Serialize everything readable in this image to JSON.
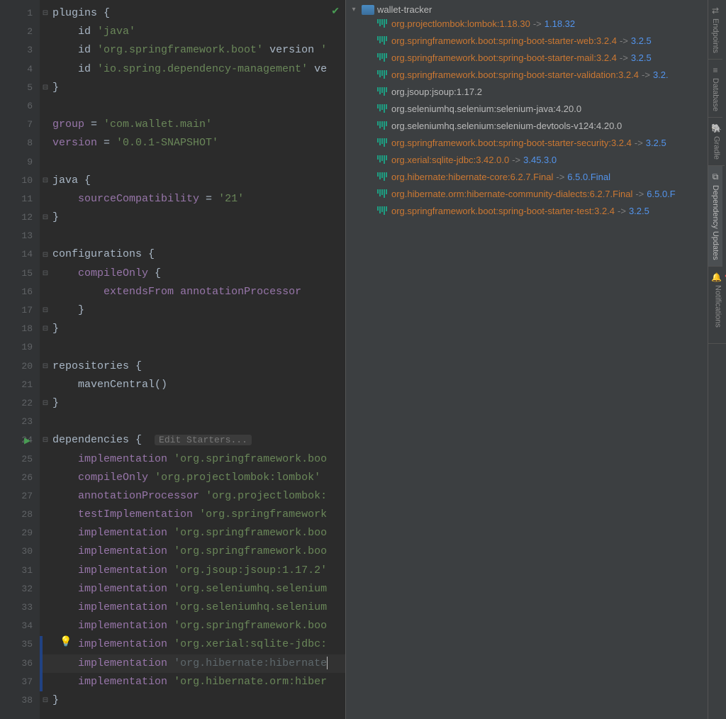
{
  "code_hint": "Edit Starters...",
  "lines": [
    {
      "n": 1,
      "fold": "-",
      "seg": [
        [
          "plain",
          "plugins "
        ],
        [
          "plain",
          "{"
        ]
      ]
    },
    {
      "n": 2,
      "seg": [
        [
          "plain",
          "    id "
        ],
        [
          "str",
          "'java'"
        ]
      ]
    },
    {
      "n": 3,
      "seg": [
        [
          "plain",
          "    id "
        ],
        [
          "str",
          "'org.springframework.boot'"
        ],
        [
          "plain",
          " version "
        ],
        [
          "str",
          "'"
        ]
      ]
    },
    {
      "n": 4,
      "seg": [
        [
          "plain",
          "    id "
        ],
        [
          "str",
          "'io.spring.dependency-management'"
        ],
        [
          "plain",
          " ve"
        ]
      ]
    },
    {
      "n": 5,
      "fold": "-",
      "seg": [
        [
          "plain",
          "}"
        ]
      ]
    },
    {
      "n": 6,
      "seg": []
    },
    {
      "n": 7,
      "seg": [
        [
          "id",
          "group"
        ],
        [
          "plain",
          " = "
        ],
        [
          "str",
          "'com.wallet.main'"
        ]
      ]
    },
    {
      "n": 8,
      "seg": [
        [
          "id",
          "version"
        ],
        [
          "plain",
          " = "
        ],
        [
          "str",
          "'0.0.1-SNAPSHOT'"
        ]
      ]
    },
    {
      "n": 9,
      "seg": []
    },
    {
      "n": 10,
      "fold": "-",
      "seg": [
        [
          "plain",
          "java "
        ],
        [
          "plain",
          "{"
        ]
      ]
    },
    {
      "n": 11,
      "seg": [
        [
          "plain",
          "    "
        ],
        [
          "id",
          "sourceCompatibility"
        ],
        [
          "plain",
          " = "
        ],
        [
          "str",
          "'21'"
        ]
      ]
    },
    {
      "n": 12,
      "fold": "-",
      "seg": [
        [
          "plain",
          "}"
        ]
      ]
    },
    {
      "n": 13,
      "seg": []
    },
    {
      "n": 14,
      "fold": "-",
      "seg": [
        [
          "plain",
          "configurations "
        ],
        [
          "plain",
          "{"
        ]
      ]
    },
    {
      "n": 15,
      "fold": "-",
      "seg": [
        [
          "plain",
          "    "
        ],
        [
          "id",
          "compileOnly"
        ],
        [
          "plain",
          " {"
        ]
      ]
    },
    {
      "n": 16,
      "seg": [
        [
          "plain",
          "        "
        ],
        [
          "id",
          "extendsFrom"
        ],
        [
          "plain",
          " "
        ],
        [
          "id",
          "annotationProcessor"
        ]
      ]
    },
    {
      "n": 17,
      "fold": "-",
      "seg": [
        [
          "plain",
          "    }"
        ]
      ]
    },
    {
      "n": 18,
      "fold": "-",
      "seg": [
        [
          "plain",
          "}"
        ]
      ]
    },
    {
      "n": 19,
      "seg": []
    },
    {
      "n": 20,
      "fold": "-",
      "seg": [
        [
          "plain",
          "repositories "
        ],
        [
          "plain",
          "{"
        ]
      ]
    },
    {
      "n": 21,
      "seg": [
        [
          "plain",
          "    mavenCentral()"
        ]
      ]
    },
    {
      "n": 22,
      "fold": "-",
      "seg": [
        [
          "plain",
          "}"
        ]
      ]
    },
    {
      "n": 23,
      "seg": []
    },
    {
      "n": 24,
      "fold": "-",
      "hint": true,
      "seg": [
        [
          "plain",
          "dependencies "
        ],
        [
          "plain",
          "{  "
        ]
      ]
    },
    {
      "n": 25,
      "seg": [
        [
          "plain",
          "    "
        ],
        [
          "id",
          "implementation"
        ],
        [
          "plain",
          " "
        ],
        [
          "str",
          "'org.springframework.boo"
        ]
      ]
    },
    {
      "n": 26,
      "seg": [
        [
          "plain",
          "    "
        ],
        [
          "id",
          "compileOnly"
        ],
        [
          "plain",
          " "
        ],
        [
          "str",
          "'org.projectlombok:lombok'"
        ]
      ]
    },
    {
      "n": 27,
      "seg": [
        [
          "plain",
          "    "
        ],
        [
          "id",
          "annotationProcessor"
        ],
        [
          "plain",
          " "
        ],
        [
          "str",
          "'org.projectlombok:"
        ]
      ]
    },
    {
      "n": 28,
      "seg": [
        [
          "plain",
          "    "
        ],
        [
          "id",
          "testImplementation"
        ],
        [
          "plain",
          " "
        ],
        [
          "str",
          "'org.springframework"
        ]
      ]
    },
    {
      "n": 29,
      "seg": [
        [
          "plain",
          "    "
        ],
        [
          "id",
          "implementation"
        ],
        [
          "plain",
          " "
        ],
        [
          "str",
          "'org.springframework.boo"
        ]
      ]
    },
    {
      "n": 30,
      "seg": [
        [
          "plain",
          "    "
        ],
        [
          "id",
          "implementation"
        ],
        [
          "plain",
          " "
        ],
        [
          "str",
          "'org.springframework.boo"
        ]
      ]
    },
    {
      "n": 31,
      "seg": [
        [
          "plain",
          "    "
        ],
        [
          "id",
          "implementation"
        ],
        [
          "plain",
          " "
        ],
        [
          "str",
          "'org.jsoup:jsoup:1.17.2'"
        ]
      ]
    },
    {
      "n": 32,
      "seg": [
        [
          "plain",
          "    "
        ],
        [
          "id",
          "implementation"
        ],
        [
          "plain",
          " "
        ],
        [
          "str",
          "'org.seleniumhq.selenium"
        ]
      ]
    },
    {
      "n": 33,
      "seg": [
        [
          "plain",
          "    "
        ],
        [
          "id",
          "implementation"
        ],
        [
          "plain",
          " "
        ],
        [
          "str",
          "'org.seleniumhq.selenium"
        ]
      ]
    },
    {
      "n": 34,
      "seg": [
        [
          "plain",
          "    "
        ],
        [
          "id",
          "implementation"
        ],
        [
          "plain",
          " "
        ],
        [
          "str",
          "'org.springframework.boo"
        ]
      ]
    },
    {
      "n": 35,
      "seg": [
        [
          "plain",
          "    "
        ],
        [
          "id",
          "implementation"
        ],
        [
          "plain",
          " "
        ],
        [
          "str",
          "'org.xerial:sqlite-jdbc:"
        ]
      ]
    },
    {
      "n": 36,
      "seg": [
        [
          "plain",
          "    "
        ],
        [
          "id",
          "implementation"
        ],
        [
          "plain",
          " "
        ],
        [
          "dim",
          "'org.hibernate:hibernate"
        ]
      ]
    },
    {
      "n": 37,
      "seg": [
        [
          "plain",
          "    "
        ],
        [
          "id",
          "implementation"
        ],
        [
          "plain",
          " "
        ],
        [
          "str",
          "'org.hibernate.orm:hiber"
        ]
      ]
    },
    {
      "n": 38,
      "fold": "-",
      "seg": [
        [
          "plain",
          "}"
        ]
      ]
    }
  ],
  "project_name": "wallet-tracker",
  "deps": [
    {
      "name": "org.projectlombok:lombok:1.18.30",
      "new": "1.18.32"
    },
    {
      "name": "org.springframework.boot:spring-boot-starter-web:3.2.4",
      "new": "3.2.5"
    },
    {
      "name": "org.springframework.boot:spring-boot-starter-mail:3.2.4",
      "new": "3.2.5"
    },
    {
      "name": "org.springframework.boot:spring-boot-starter-validation:3.2.4",
      "new": "3.2."
    },
    {
      "name": "org.jsoup:jsoup:1.17.2"
    },
    {
      "name": "org.seleniumhq.selenium:selenium-java:4.20.0"
    },
    {
      "name": "org.seleniumhq.selenium:selenium-devtools-v124:4.20.0"
    },
    {
      "name": "org.springframework.boot:spring-boot-starter-security:3.2.4",
      "new": "3.2.5"
    },
    {
      "name": "org.xerial:sqlite-jdbc:3.42.0.0",
      "new": "3.45.3.0"
    },
    {
      "name": "org.hibernate:hibernate-core:6.2.7.Final",
      "new": "6.5.0.Final"
    },
    {
      "name": "org.hibernate.orm:hibernate-community-dialects:6.2.7.Final",
      "new": "6.5.0.F"
    },
    {
      "name": "org.springframework.boot:spring-boot-starter-test:3.2.4",
      "new": "3.2.5"
    }
  ],
  "arrow": "->",
  "toolwindows": [
    {
      "id": "endpoints",
      "label": "Endpoints",
      "icon": "⇄"
    },
    {
      "id": "database",
      "label": "Database",
      "icon": "≡"
    },
    {
      "id": "gradle",
      "label": "Gradle",
      "icon": "🐘"
    },
    {
      "id": "dependency-updates",
      "label": "Dependency Updates",
      "icon": "⧉",
      "active": true
    },
    {
      "id": "notifications",
      "label": "Notifications",
      "icon": "🔔",
      "dot": true
    }
  ]
}
